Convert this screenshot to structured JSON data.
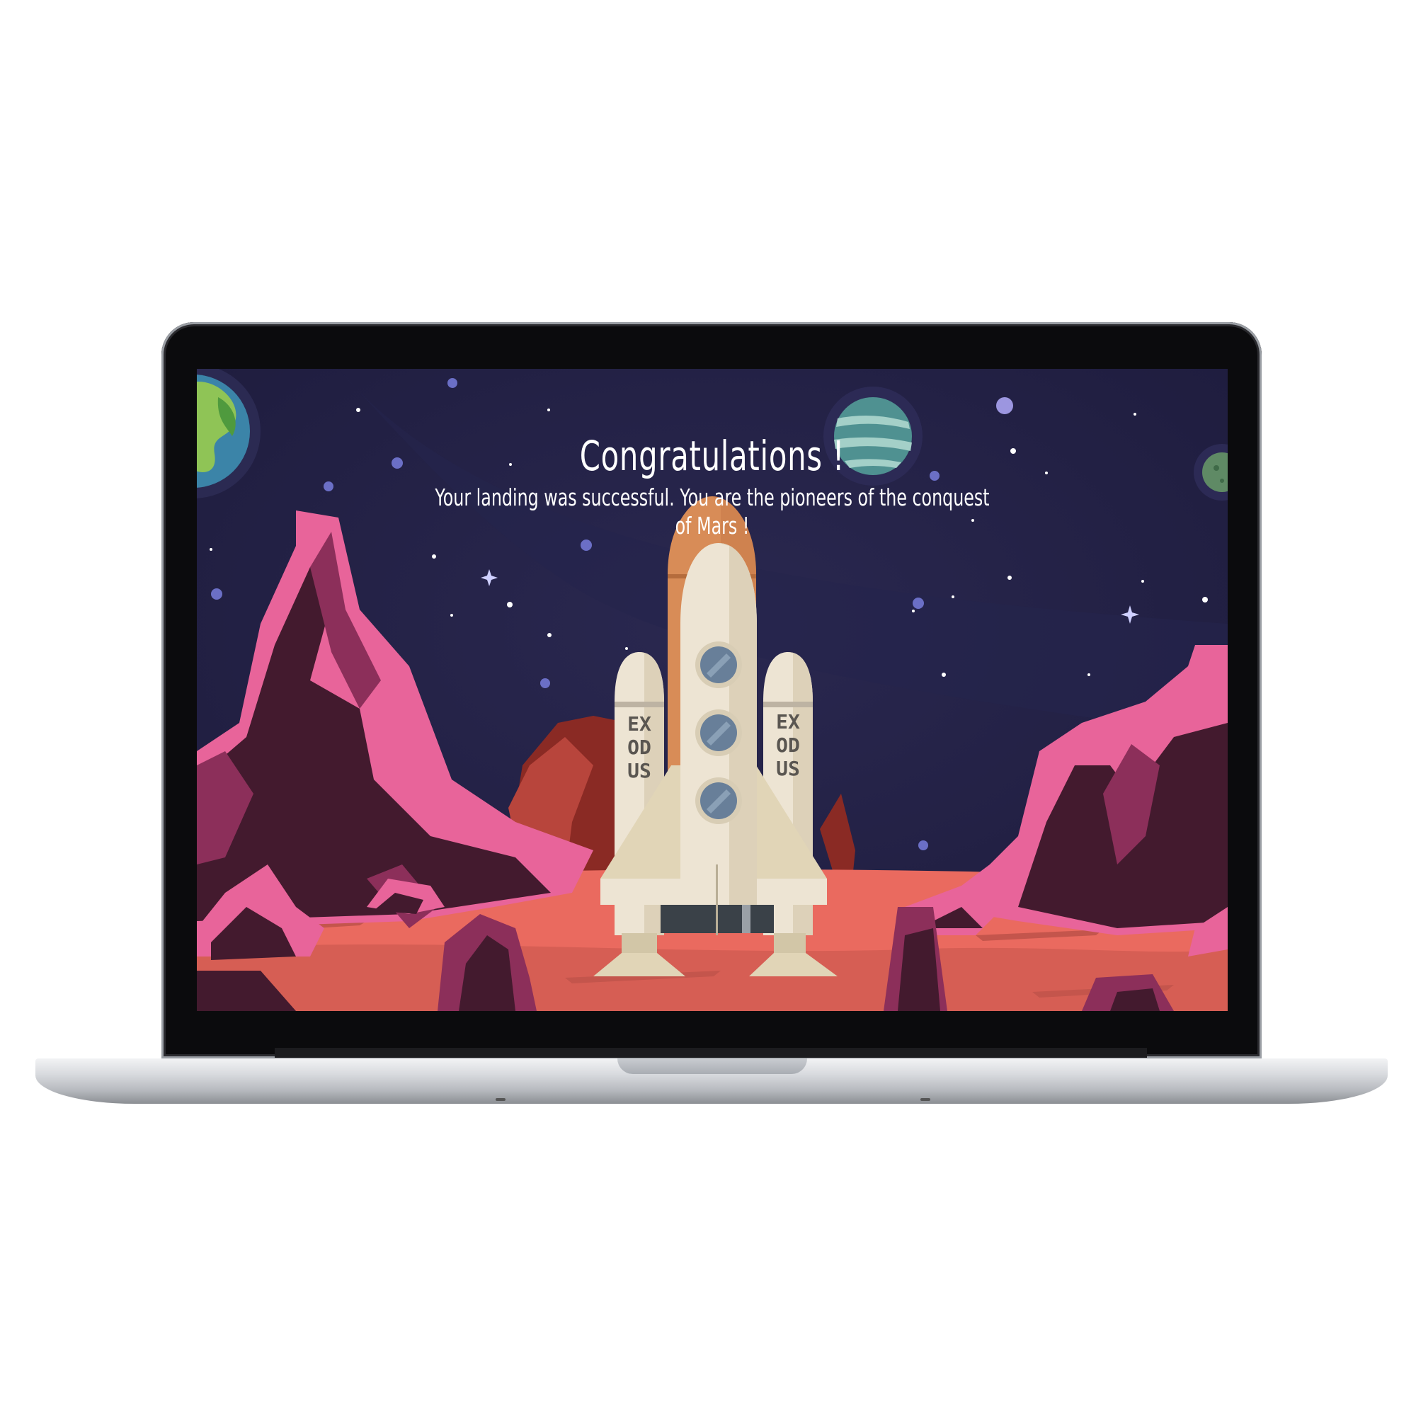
{
  "screen": {
    "heading": "Congratulations !",
    "message": "Your landing was successful. You are the pioneers of the conquest of Mars !"
  },
  "rocket": {
    "left_booster_label": [
      "EX",
      "OD",
      "US"
    ],
    "right_booster_label": [
      "EX",
      "OD",
      "US"
    ]
  },
  "colors": {
    "sky": "#22204a",
    "ground": "#ea6a5f",
    "rock_pink": "#e8649a",
    "rock_dark": "#431a2e",
    "rocket_nose": "#d88c57",
    "rocket_body": "#ede4d3"
  }
}
